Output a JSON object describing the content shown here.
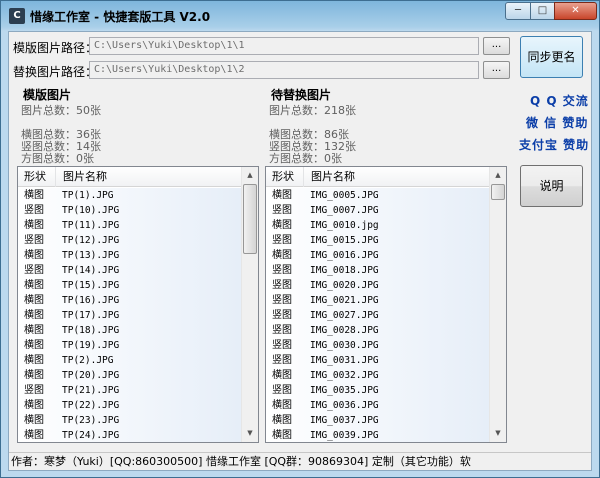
{
  "window": {
    "title": "惜缘工作室 - 快捷套版工具 V2.0",
    "min_glyph": "─",
    "max_glyph": "□",
    "close_glyph": "✕"
  },
  "paths": {
    "template_label": "模版图片路径：",
    "template_value": "C:\\Users\\Yuki\\Desktop\\1\\1",
    "replace_label": "替换图片路径：",
    "replace_value": "C:\\Users\\Yuki\\Desktop\\1\\2",
    "browse_label": "..."
  },
  "buttons": {
    "sync_rename": "同步更名",
    "help": "说明"
  },
  "links": {
    "qq": "Q Q 交流",
    "wechat": "微 信 赞助",
    "alipay": "支付宝 赞助"
  },
  "left_panel": {
    "title": "模版图片",
    "total": "图片总数：50张",
    "landscape": "横图总数：36张",
    "portrait": "竖图总数：14张",
    "square": "方图总数：0张",
    "col_shape": "形状",
    "col_name": "图片名称",
    "rows": [
      {
        "shape": "横图",
        "name": "TP(1).JPG"
      },
      {
        "shape": "竖图",
        "name": "TP(10).JPG"
      },
      {
        "shape": "横图",
        "name": "TP(11).JPG"
      },
      {
        "shape": "竖图",
        "name": "TP(12).JPG"
      },
      {
        "shape": "横图",
        "name": "TP(13).JPG"
      },
      {
        "shape": "竖图",
        "name": "TP(14).JPG"
      },
      {
        "shape": "横图",
        "name": "TP(15).JPG"
      },
      {
        "shape": "横图",
        "name": "TP(16).JPG"
      },
      {
        "shape": "横图",
        "name": "TP(17).JPG"
      },
      {
        "shape": "横图",
        "name": "TP(18).JPG"
      },
      {
        "shape": "横图",
        "name": "TP(19).JPG"
      },
      {
        "shape": "横图",
        "name": "TP(2).JPG"
      },
      {
        "shape": "横图",
        "name": "TP(20).JPG"
      },
      {
        "shape": "竖图",
        "name": "TP(21).JPG"
      },
      {
        "shape": "横图",
        "name": "TP(22).JPG"
      },
      {
        "shape": "横图",
        "name": "TP(23).JPG"
      },
      {
        "shape": "横图",
        "name": "TP(24).JPG"
      }
    ]
  },
  "right_panel": {
    "title": "待替换图片",
    "total": "图片总数：218张",
    "landscape": "横图总数：86张",
    "portrait": "竖图总数：132张",
    "square": "方图总数：0张",
    "col_shape": "形状",
    "col_name": "图片名称",
    "rows": [
      {
        "shape": "横图",
        "name": "IMG_0005.JPG"
      },
      {
        "shape": "竖图",
        "name": "IMG_0007.JPG"
      },
      {
        "shape": "横图",
        "name": "IMG_0010.jpg"
      },
      {
        "shape": "竖图",
        "name": "IMG_0015.JPG"
      },
      {
        "shape": "横图",
        "name": "IMG_0016.JPG"
      },
      {
        "shape": "竖图",
        "name": "IMG_0018.JPG"
      },
      {
        "shape": "竖图",
        "name": "IMG_0020.JPG"
      },
      {
        "shape": "竖图",
        "name": "IMG_0021.JPG"
      },
      {
        "shape": "竖图",
        "name": "IMG_0027.JPG"
      },
      {
        "shape": "竖图",
        "name": "IMG_0028.JPG"
      },
      {
        "shape": "竖图",
        "name": "IMG_0030.JPG"
      },
      {
        "shape": "竖图",
        "name": "IMG_0031.JPG"
      },
      {
        "shape": "横图",
        "name": "IMG_0032.JPG"
      },
      {
        "shape": "竖图",
        "name": "IMG_0035.JPG"
      },
      {
        "shape": "横图",
        "name": "IMG_0036.JPG"
      },
      {
        "shape": "横图",
        "name": "IMG_0037.JPG"
      },
      {
        "shape": "横图",
        "name": "IMG_0039.JPG"
      }
    ]
  },
  "status": {
    "text": "作者：寒梦（Yuki）[QQ:860300500]  惜缘工作室 [QQ群：90869304]     定制（其它功能）软"
  }
}
